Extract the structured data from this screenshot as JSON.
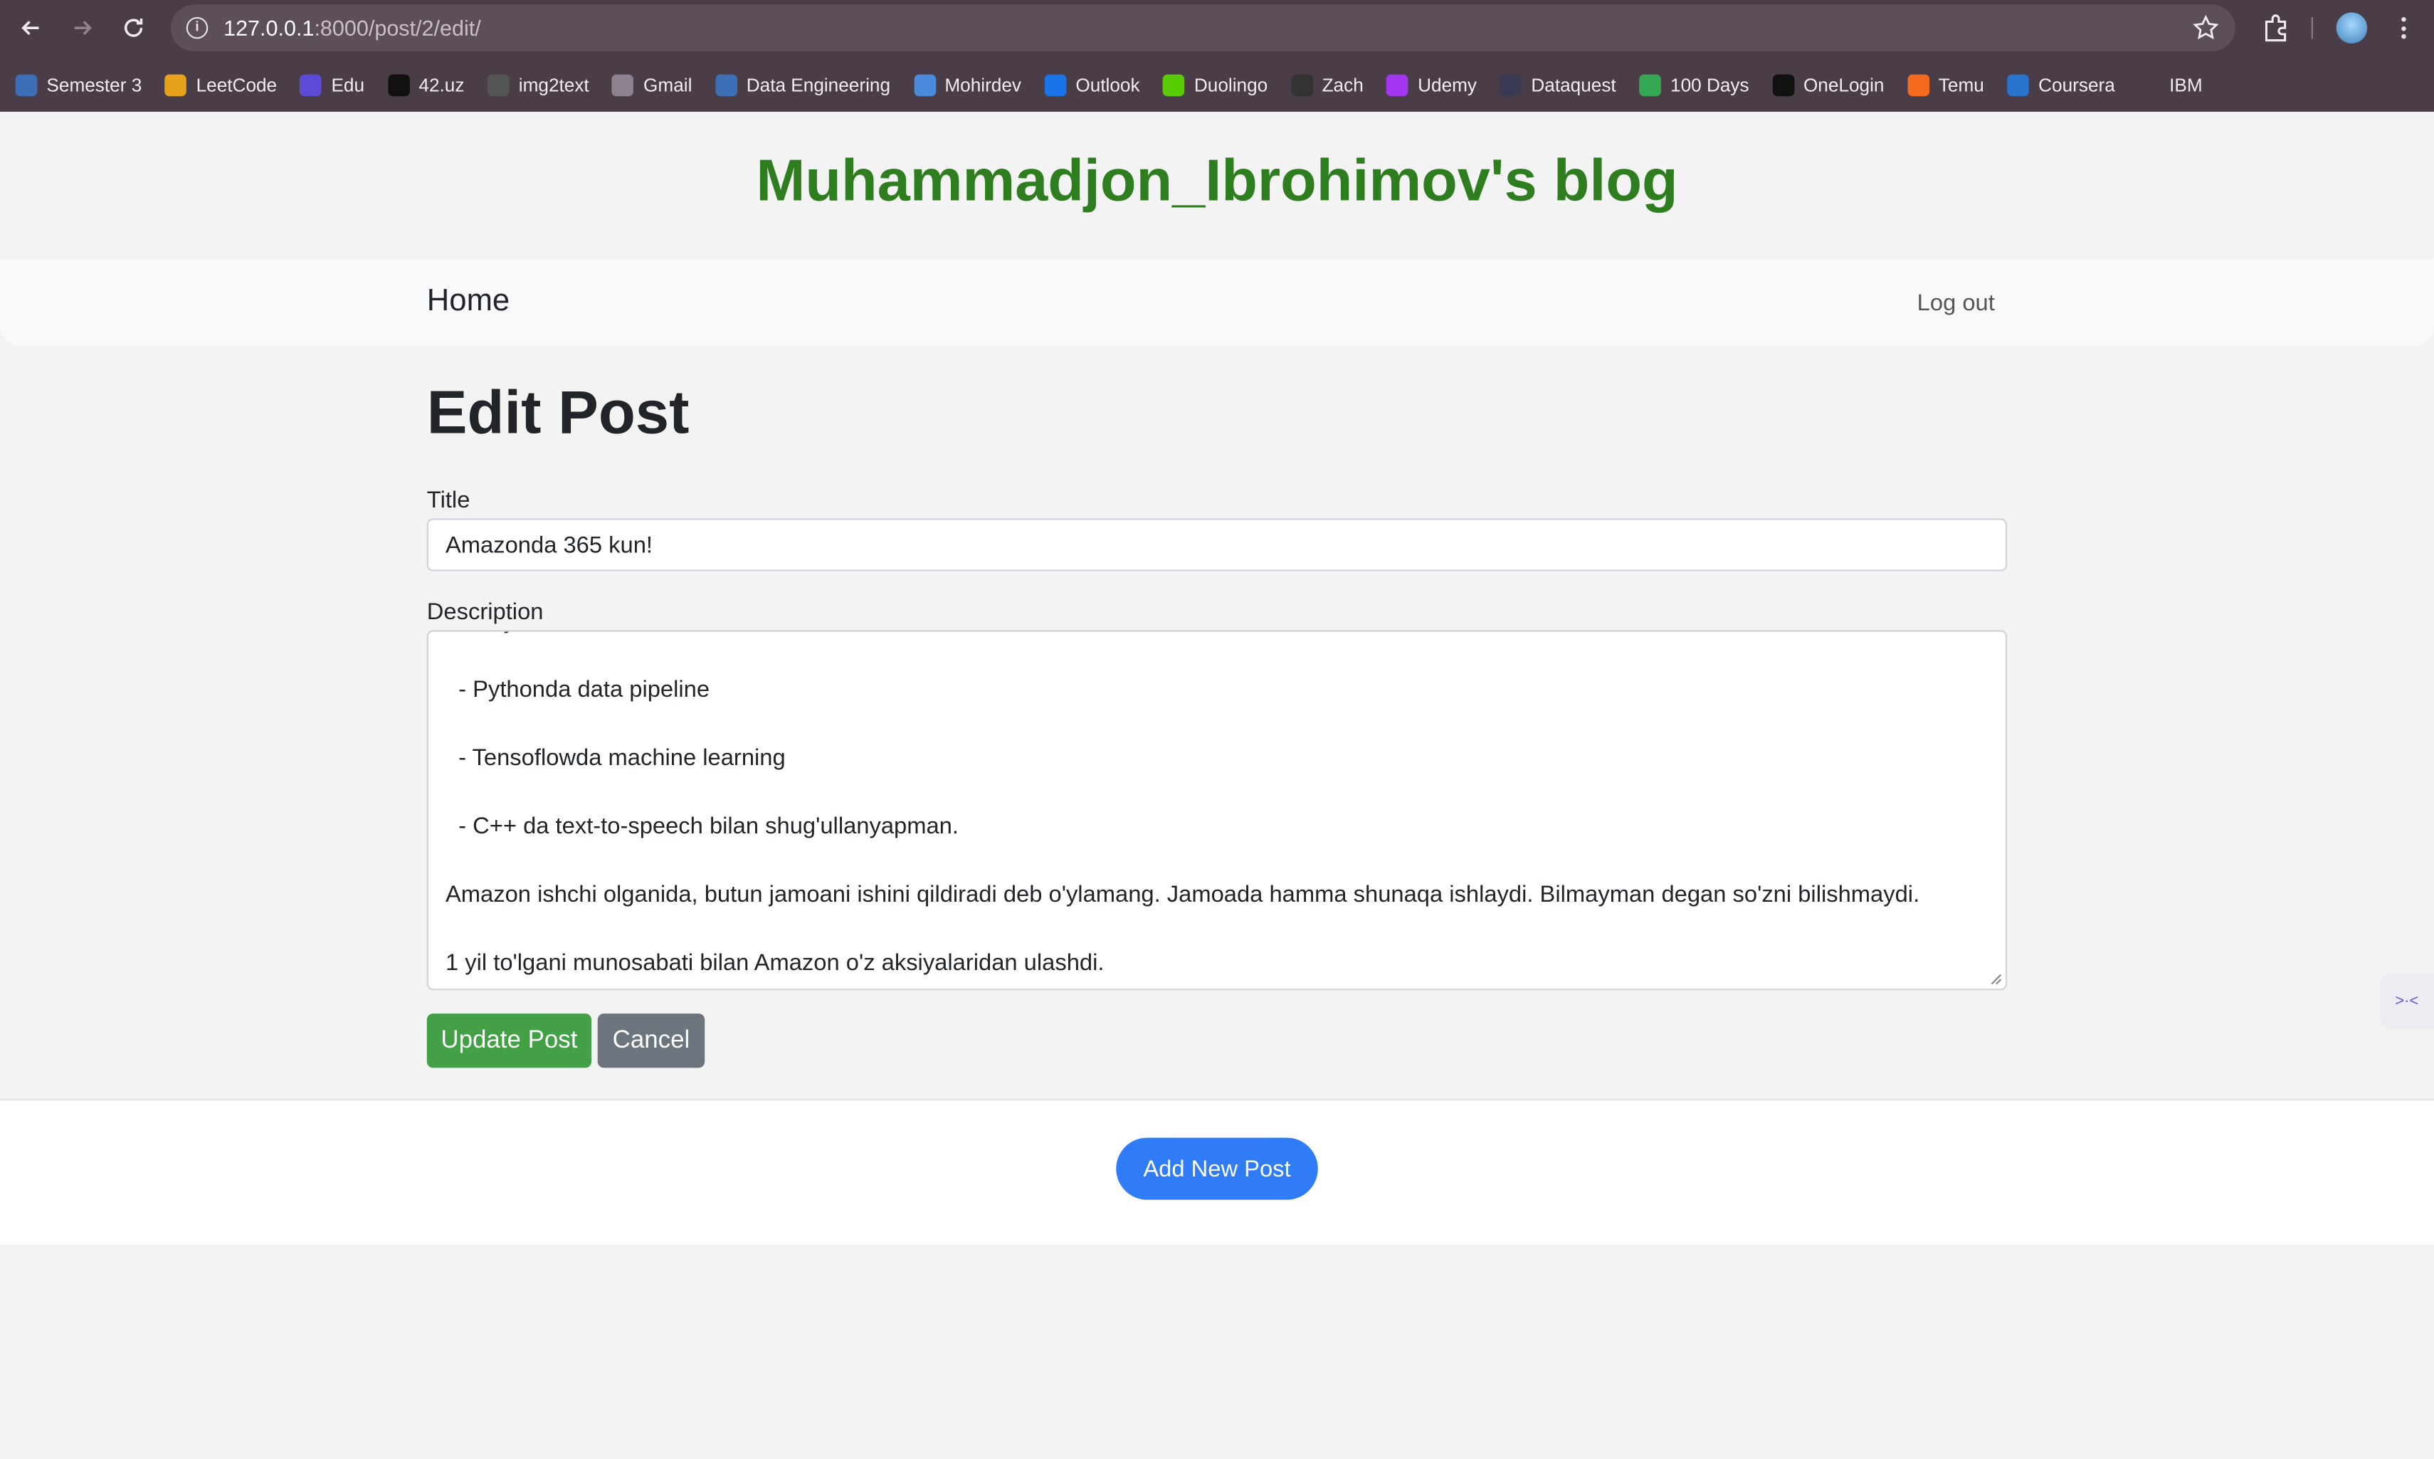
{
  "browser": {
    "url_host": "127.0.0.1",
    "url_path": ":8000/post/2/edit/",
    "bookmarks": [
      {
        "label": "Semester 3",
        "icon": "folder-icon",
        "color": "#3d6fb6"
      },
      {
        "label": "LeetCode",
        "icon": "leetcode-icon",
        "color": "#e7a11a"
      },
      {
        "label": "Edu",
        "icon": "edu-icon",
        "color": "#5b4bd6"
      },
      {
        "label": "42.uz",
        "icon": "42-icon",
        "color": "#111111"
      },
      {
        "label": "img2text",
        "icon": "img2text-icon",
        "color": "#555555"
      },
      {
        "label": "Gmail",
        "icon": "folder-icon",
        "color": "#8d8290"
      },
      {
        "label": "Data Engineering",
        "icon": "folder-icon",
        "color": "#3d6fb6"
      },
      {
        "label": "Mohirdev",
        "icon": "mohirdev-icon",
        "color": "#4a8bdc"
      },
      {
        "label": "Outlook",
        "icon": "outlook-icon",
        "color": "#1a73e8"
      },
      {
        "label": "Duolingo",
        "icon": "duolingo-icon",
        "color": "#58cc02"
      },
      {
        "label": "Zach",
        "icon": "zach-icon",
        "color": "#333333"
      },
      {
        "label": "Udemy",
        "icon": "udemy-icon",
        "color": "#a435f0"
      },
      {
        "label": "Dataquest",
        "icon": "dataquest-icon",
        "color": "#3a3a55"
      },
      {
        "label": "100 Days",
        "icon": "sheets-icon",
        "color": "#34a853"
      },
      {
        "label": "OneLogin",
        "icon": "onelogin-icon",
        "color": "#111111"
      },
      {
        "label": "Temu",
        "icon": "temu-icon",
        "color": "#f46b1f"
      },
      {
        "label": "Coursera",
        "icon": "coursera-icon",
        "color": "#2a73cc"
      },
      {
        "label": "IBM",
        "icon": "ibm-icon",
        "color": "#4a3d48"
      }
    ]
  },
  "header": {
    "blog_title": "Muhammadjon_Ibrohimov's blog"
  },
  "nav": {
    "home": "Home",
    "logout": "Log out"
  },
  "form": {
    "heading": "Edit Post",
    "title_label": "Title",
    "title_value": "Amazonda 365 kun!",
    "description_label": "Description",
    "description_value": "  - Tinybird\n\n  - Pythonda data pipeline\n\n  - Tensoflowda machine learning\n\n  - C++ da text-to-speech bilan shug'ullanyapman.\n\nAmazon ishchi olganida, butun jamoani ishini qildiradi deb o'ylamang. Jamoada hamma shunaqa ishlaydi. Bilmayman degan so'zni bilishmaydi.\n\n1 yil to'lgani munosabati bilan Amazon o'z aksiyalaridan ulashdi.",
    "update_button": "Update Post",
    "cancel_button": "Cancel"
  },
  "footer": {
    "add_button": "Add New Post"
  },
  "colors": {
    "blog_title": "#2e7d1f",
    "update": "#43a047",
    "cancel": "#6c757d",
    "add": "#2f7cf6"
  }
}
